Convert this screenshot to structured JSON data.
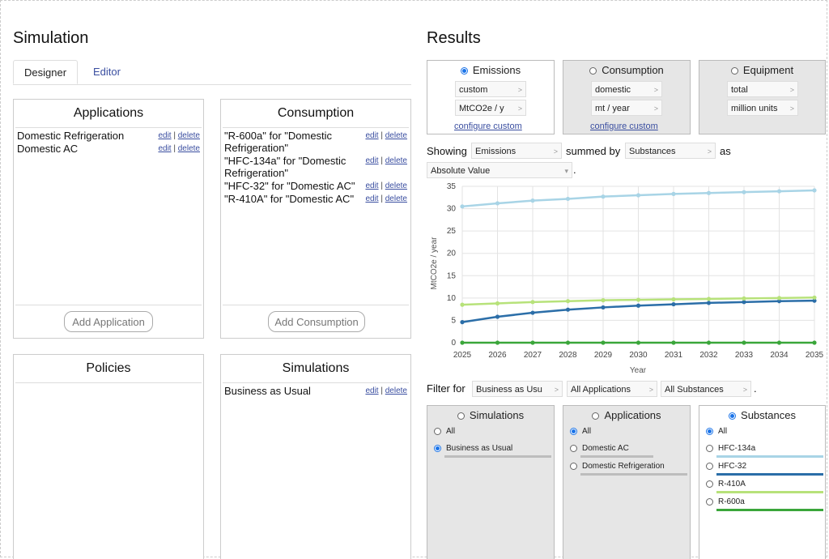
{
  "simulation": {
    "title": "Simulation",
    "tabs": [
      {
        "label": "Designer",
        "active": true
      },
      {
        "label": "Editor",
        "active": false
      }
    ],
    "applications": {
      "title": "Applications",
      "items": [
        "Domestic Refrigeration",
        "Domestic AC"
      ],
      "add_label": "Add Application"
    },
    "consumption": {
      "title": "Consumption",
      "items": [
        "\"R-600a\" for \"Domestic Refrigeration\"",
        "\"HFC-134a\" for \"Domestic Refrigeration\"",
        "\"HFC-32\" for \"Domestic AC\"",
        "\"R-410A\" for \"Domestic AC\""
      ],
      "add_label": "Add Consumption"
    },
    "policies": {
      "title": "Policies"
    },
    "simulations": {
      "title": "Simulations",
      "items": [
        "Business as Usual"
      ]
    },
    "edit_label": "edit",
    "sep": "|",
    "delete_label": "delete"
  },
  "results": {
    "title": "Results",
    "metrics": [
      {
        "label": "Emissions",
        "selected": true,
        "opt1": "custom",
        "opt2": "MtCO2e / y",
        "configure": "configure custom"
      },
      {
        "label": "Consumption",
        "selected": false,
        "opt1": "domestic",
        "opt2": "mt / year",
        "configure": "configure custom"
      },
      {
        "label": "Equipment",
        "selected": false,
        "opt1": "total",
        "opt2": "million units",
        "configure": ""
      }
    ],
    "showing_label": "Showing",
    "showing_value": "Emissions",
    "summed_by_label": "summed by",
    "summed_by_value": "Substances",
    "as_label": "as",
    "as_value": "Absolute Value",
    "period": ".",
    "filter_label": "Filter for",
    "filter_values": [
      "Business as Usu",
      "All Applications",
      "All Substances"
    ],
    "filter_period": ".",
    "filters": {
      "simulations": {
        "title": "Simulations",
        "selected": false,
        "options": [
          {
            "label": "All",
            "on": false
          },
          {
            "label": "Business as Usual",
            "on": true
          }
        ]
      },
      "applications": {
        "title": "Applications",
        "selected": false,
        "options": [
          {
            "label": "All",
            "on": true
          },
          {
            "label": "Domestic AC",
            "on": false
          },
          {
            "label": "Domestic Refrigeration",
            "on": false
          }
        ]
      },
      "substances": {
        "title": "Substances",
        "selected": true,
        "options": [
          {
            "label": "All",
            "on": true
          },
          {
            "label": "HFC-134a",
            "on": false,
            "color": "#a8d4e6"
          },
          {
            "label": "HFC-32",
            "on": false,
            "color": "#2b6ea8"
          },
          {
            "label": "R-410A",
            "on": false,
            "color": "#b7e27a"
          },
          {
            "label": "R-600a",
            "on": false,
            "color": "#3aa63a"
          }
        ]
      }
    }
  },
  "chart_data": {
    "type": "line",
    "x": [
      2025,
      2026,
      2027,
      2028,
      2029,
      2030,
      2031,
      2032,
      2033,
      2034,
      2035
    ],
    "xlabel": "Year",
    "ylabel": "MtCO2e / year",
    "ylim": [
      0,
      35
    ],
    "yticks": [
      0,
      5,
      10,
      15,
      20,
      25,
      30,
      35
    ],
    "grid": true,
    "series": [
      {
        "name": "HFC-134a",
        "color": "#a8d4e6",
        "values": [
          30.5,
          31.2,
          31.8,
          32.2,
          32.7,
          33.0,
          33.3,
          33.5,
          33.7,
          33.9,
          34.1
        ]
      },
      {
        "name": "HFC-32",
        "color": "#2b6ea8",
        "values": [
          4.6,
          5.8,
          6.7,
          7.4,
          7.9,
          8.3,
          8.6,
          8.9,
          9.1,
          9.3,
          9.4
        ]
      },
      {
        "name": "R-410A",
        "color": "#b7e27a",
        "values": [
          8.5,
          8.8,
          9.1,
          9.3,
          9.5,
          9.6,
          9.7,
          9.8,
          9.9,
          10.0,
          10.1
        ]
      },
      {
        "name": "R-600a",
        "color": "#3aa63a",
        "values": [
          0,
          0,
          0,
          0,
          0,
          0,
          0,
          0,
          0,
          0,
          0
        ]
      }
    ]
  }
}
